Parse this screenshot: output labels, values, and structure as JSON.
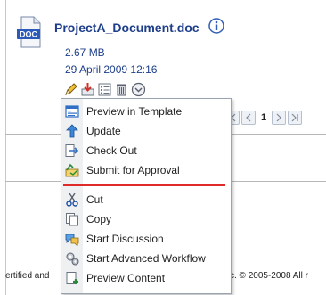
{
  "document": {
    "title": "ProjectA_Document.doc",
    "icon_label": "DOC",
    "size": "2.67 MB",
    "date": "29 April 2009 12:16"
  },
  "toolbar": [
    "edit-icon",
    "download-icon",
    "properties-icon",
    "delete-icon",
    "more-actions-icon"
  ],
  "pager": {
    "page": "1"
  },
  "footer": {
    "left": "ertified and",
    "right": "c. © 2005-2008 All r"
  },
  "menu": {
    "items": [
      {
        "label": "Preview in Template",
        "icon": "preview-template-icon"
      },
      {
        "label": "Update",
        "icon": "update-icon"
      },
      {
        "label": "Check Out",
        "icon": "check-out-icon"
      },
      {
        "label": "Submit for Approval",
        "icon": "submit-approval-icon"
      },
      {
        "label": "Cut",
        "icon": "cut-icon"
      },
      {
        "label": "Copy",
        "icon": "copy-icon"
      },
      {
        "label": "Start Discussion",
        "icon": "discussion-icon"
      },
      {
        "label": "Start Advanced Workflow",
        "icon": "workflow-icon"
      },
      {
        "label": "Preview Content",
        "icon": "preview-content-icon"
      }
    ]
  },
  "colors": {
    "title": "#1d3e8a",
    "highlight_underline": "#e02a2a",
    "menu_border": "#9aa4b0"
  }
}
